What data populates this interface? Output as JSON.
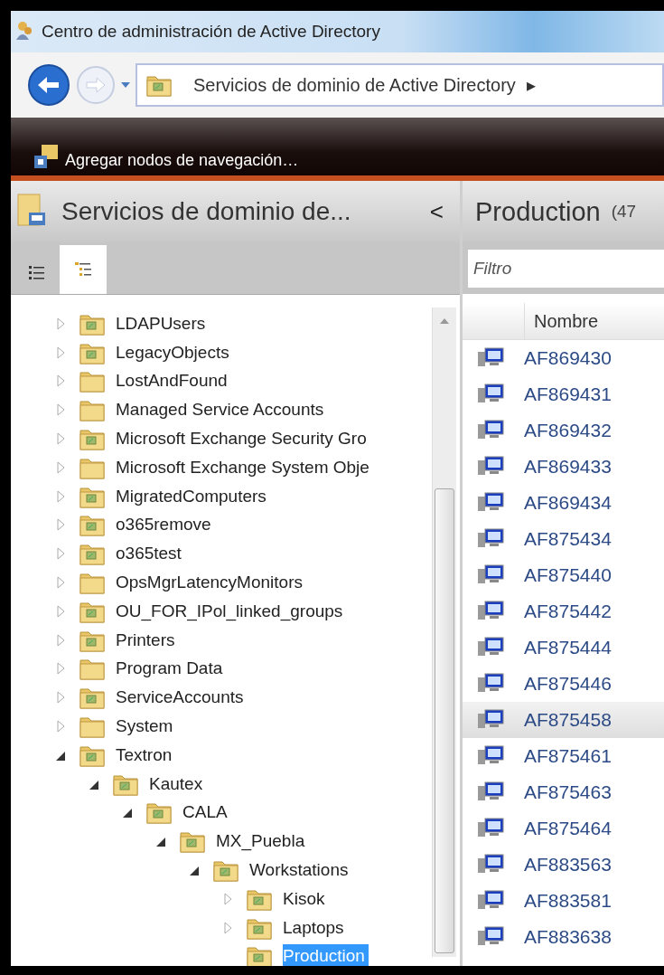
{
  "window": {
    "title": "Centro de administración de Active Directory"
  },
  "address_bar": {
    "path": "Servicios de dominio de Active Directory",
    "separator": "▸"
  },
  "toolbar": {
    "label": "Agregar nodos de navegación…"
  },
  "navigation": {
    "title": "Servicios de dominio de...",
    "collapse": "<",
    "view_tabs": [
      {
        "kind": "list",
        "selected": false
      },
      {
        "kind": "tree",
        "selected": true
      }
    ],
    "tree": [
      {
        "label": "LDAPUsers",
        "kind": "ou",
        "expandable": true,
        "expanded": false,
        "selected": false
      },
      {
        "label": "LegacyObjects",
        "kind": "ou",
        "expandable": true,
        "expanded": false,
        "selected": false
      },
      {
        "label": "LostAndFound",
        "kind": "container",
        "expandable": true,
        "expanded": false,
        "selected": false
      },
      {
        "label": "Managed Service Accounts",
        "kind": "container",
        "expandable": true,
        "expanded": false,
        "selected": false
      },
      {
        "label": "Microsoft Exchange Security Gro",
        "kind": "ou",
        "expandable": true,
        "expanded": false,
        "selected": false
      },
      {
        "label": "Microsoft Exchange System Obje",
        "kind": "container",
        "expandable": true,
        "expanded": false,
        "selected": false
      },
      {
        "label": "MigratedComputers",
        "kind": "ou",
        "expandable": true,
        "expanded": false,
        "selected": false
      },
      {
        "label": "o365remove",
        "kind": "ou",
        "expandable": true,
        "expanded": false,
        "selected": false
      },
      {
        "label": "o365test",
        "kind": "ou",
        "expandable": true,
        "expanded": false,
        "selected": false
      },
      {
        "label": "OpsMgrLatencyMonitors",
        "kind": "container",
        "expandable": true,
        "expanded": false,
        "selected": false
      },
      {
        "label": "OU_FOR_IPol_linked_groups",
        "kind": "ou",
        "expandable": true,
        "expanded": false,
        "selected": false
      },
      {
        "label": "Printers",
        "kind": "ou",
        "expandable": true,
        "expanded": false,
        "selected": false
      },
      {
        "label": "Program Data",
        "kind": "container",
        "expandable": true,
        "expanded": false,
        "selected": false
      },
      {
        "label": "ServiceAccounts",
        "kind": "ou",
        "expandable": true,
        "expanded": false,
        "selected": false
      },
      {
        "label": "System",
        "kind": "container",
        "expandable": true,
        "expanded": false,
        "selected": false
      },
      {
        "label": "Textron",
        "kind": "ou",
        "expandable": true,
        "expanded": true,
        "selected": false,
        "children": [
          {
            "label": "Kautex",
            "kind": "ou",
            "expandable": true,
            "expanded": true,
            "selected": false,
            "children": [
              {
                "label": "CALA",
                "kind": "ou",
                "expandable": true,
                "expanded": true,
                "selected": false,
                "children": [
                  {
                    "label": "MX_Puebla",
                    "kind": "ou",
                    "expandable": true,
                    "expanded": true,
                    "selected": false,
                    "children": [
                      {
                        "label": "Workstations",
                        "kind": "ou",
                        "expandable": true,
                        "expanded": true,
                        "selected": false,
                        "children": [
                          {
                            "label": "Kisok",
                            "kind": "ou",
                            "expandable": true,
                            "expanded": false,
                            "selected": false
                          },
                          {
                            "label": "Laptops",
                            "kind": "ou",
                            "expandable": true,
                            "expanded": false,
                            "selected": false
                          },
                          {
                            "label": "Production",
                            "kind": "ou",
                            "expandable": false,
                            "selected": true
                          }
                        ]
                      }
                    ]
                  }
                ]
              }
            ]
          }
        ]
      }
    ]
  },
  "content": {
    "title": "Production",
    "count": "(47",
    "filter": {
      "placeholder": "Filtro"
    },
    "columns": [
      "Nombre"
    ],
    "rows": [
      {
        "name": "AF869430",
        "hovered": false
      },
      {
        "name": "AF869431",
        "hovered": false
      },
      {
        "name": "AF869432",
        "hovered": false
      },
      {
        "name": "AF869433",
        "hovered": false
      },
      {
        "name": "AF869434",
        "hovered": false
      },
      {
        "name": "AF875434",
        "hovered": false
      },
      {
        "name": "AF875440",
        "hovered": false
      },
      {
        "name": "AF875442",
        "hovered": false
      },
      {
        "name": "AF875444",
        "hovered": false
      },
      {
        "name": "AF875446",
        "hovered": false
      },
      {
        "name": "AF875458",
        "hovered": true
      },
      {
        "name": "AF875461",
        "hovered": false
      },
      {
        "name": "AF875463",
        "hovered": false
      },
      {
        "name": "AF875464",
        "hovered": false
      },
      {
        "name": "AF883563",
        "hovered": false
      },
      {
        "name": "AF883581",
        "hovered": false
      },
      {
        "name": "AF883638",
        "hovered": false
      }
    ]
  }
}
